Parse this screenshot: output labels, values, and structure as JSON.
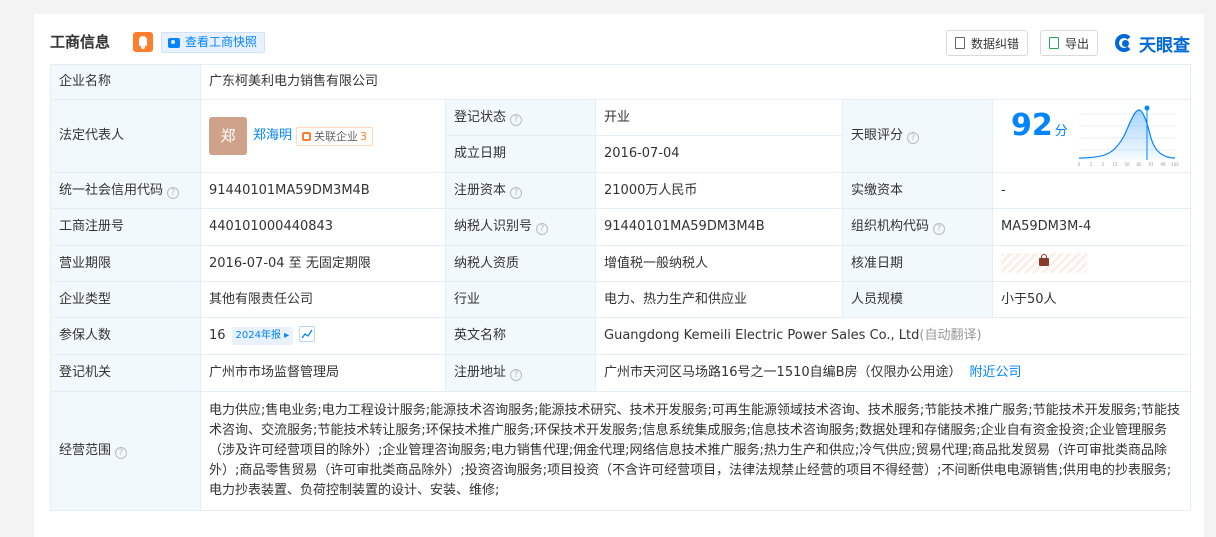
{
  "section": {
    "title": "工商信息",
    "snapshot_label": "查看工商快照",
    "error_btn": "数据纠错",
    "export_btn": "导出",
    "logo_text": "天眼查"
  },
  "rows": {
    "company_name_label": "企业名称",
    "company_name": "广东柯美利电力销售有限公司",
    "legal_rep_label": "法定代表人",
    "avatar_char": "郑",
    "legal_rep_name": "郑海明",
    "related_label": "关联企业",
    "related_count": "3",
    "reg_status_label": "登记状态",
    "reg_status": "开业",
    "est_date_label": "成立日期",
    "est_date": "2016-07-04",
    "score_label": "天眼评分",
    "score": "92",
    "score_unit": "分",
    "credit_code_label": "统一社会信用代码",
    "credit_code": "91440101MA59DM3M4B",
    "reg_capital_label": "注册资本",
    "reg_capital": "21000万人民币",
    "paid_capital_label": "实缴资本",
    "paid_capital": "-",
    "biz_reg_no_label": "工商注册号",
    "biz_reg_no": "440101000440843",
    "taxpayer_id_label": "纳税人识别号",
    "taxpayer_id": "91440101MA59DM3M4B",
    "org_code_label": "组织机构代码",
    "org_code": "MA59DM3M-4",
    "term_label": "营业期限",
    "term": "2016-07-04 至 无固定期限",
    "taxpayer_qual_label": "纳税人资质",
    "taxpayer_qual": "增值税一般纳税人",
    "approve_date_label": "核准日期",
    "type_label": "企业类型",
    "type": "其他有限责任公司",
    "industry_label": "行业",
    "industry": "电力、热力生产和供应业",
    "staff_label": "人员规模",
    "staff": "小于50人",
    "insured_label": "参保人数",
    "insured": "16",
    "report_label": "2024年报",
    "english_label": "英文名称",
    "english_name": "Guangdong Kemeili Electric Power Sales Co., Ltd",
    "auto_translate": "(自动翻译)",
    "authority_label": "登记机关",
    "authority": "广州市市场监督管理局",
    "address_label": "注册地址",
    "address": "广州市天河区马场路16号之一1510自编B房（仅限办公用途）",
    "nearby_label": "附近公司",
    "scope_label": "经营范围",
    "scope": "电力供应;售电业务;电力工程设计服务;能源技术咨询服务;能源技术研究、技术开发服务;可再生能源领域技术咨询、技术服务;节能技术推广服务;节能技术开发服务;节能技术咨询、交流服务;节能技术转让服务;环保技术推广服务;环保技术开发服务;信息系统集成服务;信息技术咨询服务;数据处理和存储服务;企业自有资金投资;企业管理服务（涉及许可经营项目的除外）;企业管理咨询服务;电力销售代理;佣金代理;网络信息技术推广服务;热力生产和供应;冷气供应;贸易代理;商品批发贸易（许可审批类商品除外）;商品零售贸易（许可审批类商品除外）;投资咨询服务;项目投资（不含许可经营项目，法律法规禁止经营的项目不得经营）;不间断供电电源销售;供用电的抄表服务;电力抄表装置、负荷控制装置的设计、安装、维修;"
  },
  "score_chart": {
    "x_ticks": [
      "0",
      "1",
      "2",
      "15",
      "50",
      "85",
      "97",
      "99",
      "100"
    ]
  },
  "colors": {
    "accent": "#0084ff",
    "status_green": "#009944",
    "label_bg": "#f2f9fc"
  }
}
